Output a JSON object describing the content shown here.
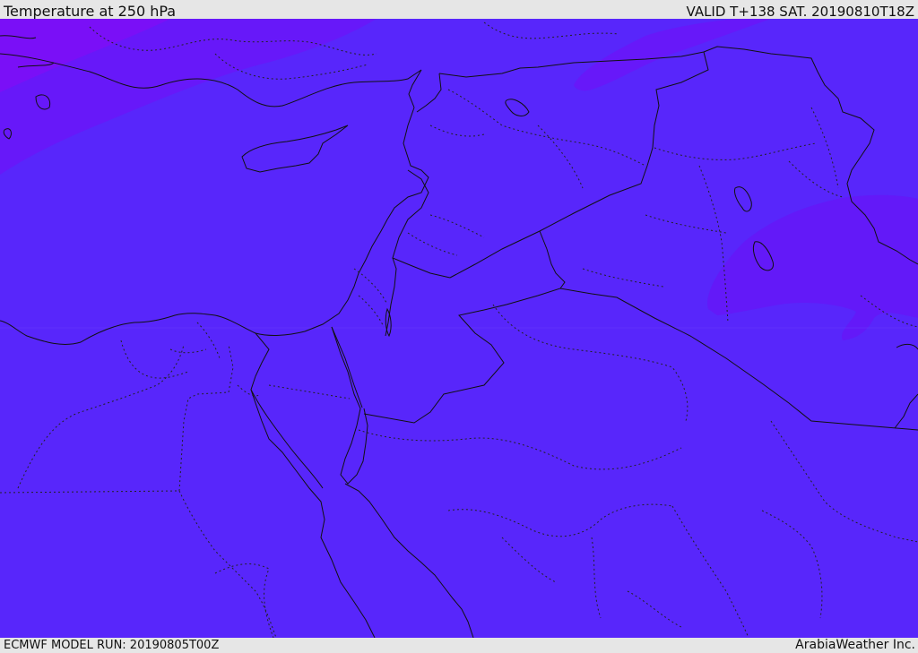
{
  "header": {
    "title": "Temperature at 250 hPa",
    "valid": "VALID T+138 SAT. 20190810T18Z"
  },
  "footer": {
    "model_run": "ECMWF MODEL RUN: 20190805T00Z",
    "credit": "ArabiaWeather Inc."
  },
  "map": {
    "field": "temperature",
    "level": "250 hPa",
    "colors": {
      "base_fill": "#5826fb",
      "cold_band_outer": "#7a0ff7",
      "cold_band_inner": "#6718f9",
      "east_cold_patch": "#6319f8",
      "coastline": "#111111",
      "borders": "#111111",
      "subdivisions": "#222222"
    }
  }
}
